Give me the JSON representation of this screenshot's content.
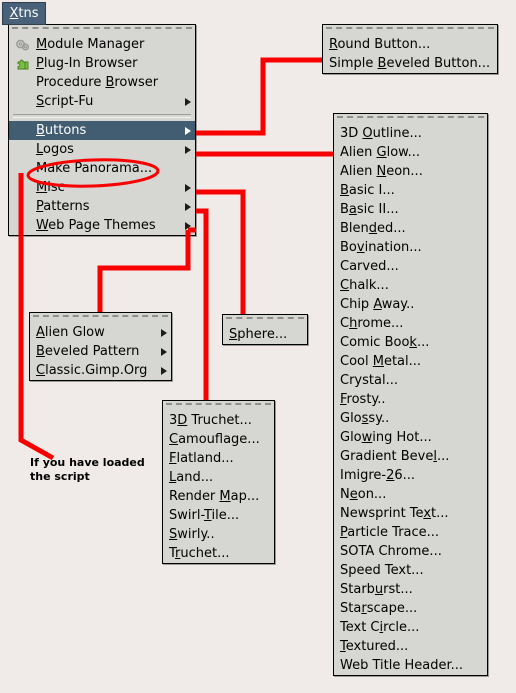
{
  "tab": {
    "label": "Xtns",
    "accel": "X",
    "bg": "#4a6279",
    "fg": "#ffffff"
  },
  "colors": {
    "background": "#f0ebe9",
    "menu_face": "#d6d6d2",
    "highlight": "#425c72",
    "annotation_red": "#f90000"
  },
  "main_menu": {
    "name": "Xtns menu",
    "items": [
      {
        "label": "Module Manager",
        "accel": "M",
        "icon": "gears-icon",
        "submenu": false
      },
      {
        "label": "Plug-In Browser",
        "accel": "P",
        "icon": "puzzle-piece-icon",
        "submenu": false
      },
      {
        "label": "Procedure Browser",
        "accel": "B",
        "icon": "",
        "submenu": false
      },
      {
        "label": "Script-Fu",
        "accel": "S",
        "icon": "",
        "submenu": true
      },
      {
        "separator": true
      },
      {
        "label": "Buttons",
        "accel": "B",
        "icon": "",
        "submenu": true,
        "selected": true
      },
      {
        "label": "Logos",
        "accel": "L",
        "icon": "",
        "submenu": true
      },
      {
        "label": "Make Panorama...",
        "accel": "",
        "icon": "",
        "submenu": false,
        "circled": true
      },
      {
        "label": "Misc",
        "accel": "M",
        "icon": "",
        "submenu": true
      },
      {
        "label": "Patterns",
        "accel": "P",
        "icon": "",
        "submenu": true
      },
      {
        "label": "Web Page Themes",
        "accel": "W",
        "icon": "",
        "submenu": true
      }
    ]
  },
  "buttons_menu": {
    "name": "Buttons submenu",
    "items": [
      {
        "label": "Round Button...",
        "accel": "R"
      },
      {
        "label": "Simple Beveled Button...",
        "accel": "B"
      }
    ]
  },
  "logos_menu": {
    "name": "Logos submenu",
    "items": [
      {
        "label": "3D Outline...",
        "accel": "O"
      },
      {
        "label": "Alien Glow...",
        "accel": "G"
      },
      {
        "label": "Alien Neon...",
        "accel": "N"
      },
      {
        "label": "Basic I...",
        "accel": "B"
      },
      {
        "label": "Basic II...",
        "accel": "a"
      },
      {
        "label": "Blended...",
        "accel": "d"
      },
      {
        "label": "Bovination...",
        "accel": "v"
      },
      {
        "label": "Carved...",
        "accel": ""
      },
      {
        "label": "Chalk...",
        "accel": "C"
      },
      {
        "label": "Chip Away..",
        "accel": "A"
      },
      {
        "label": "Chrome...",
        "accel": "h"
      },
      {
        "label": "Comic Book...",
        "accel": "k"
      },
      {
        "label": "Cool Metal...",
        "accel": "M"
      },
      {
        "label": "Crystal...",
        "accel": ""
      },
      {
        "label": "Frosty..",
        "accel": "F"
      },
      {
        "label": "Glossy..",
        "accel": "s"
      },
      {
        "label": "Glowing Hot...",
        "accel": "w"
      },
      {
        "label": "Gradient Bevel...",
        "accel": "l"
      },
      {
        "label": "Imigre-26...",
        "accel": "2"
      },
      {
        "label": "Neon...",
        "accel": "e"
      },
      {
        "label": "Newsprint Text...",
        "accel": "x"
      },
      {
        "label": "Particle Trace...",
        "accel": "P"
      },
      {
        "label": "SOTA Chrome...",
        "accel": ""
      },
      {
        "label": "Speed Text...",
        "accel": ""
      },
      {
        "label": "Starburst...",
        "accel": "u"
      },
      {
        "label": "Starscape...",
        "accel": "r"
      },
      {
        "label": "Text Circle...",
        "accel": "i"
      },
      {
        "label": "Textured...",
        "accel": "T"
      },
      {
        "label": "Web Title Header...",
        "accel": ""
      }
    ]
  },
  "misc_menu": {
    "name": "Misc submenu",
    "items": [
      {
        "label": "Sphere...",
        "accel": "S"
      }
    ]
  },
  "webpage_themes_menu": {
    "name": "Web Page Themes submenu",
    "items": [
      {
        "label": "Alien Glow",
        "accel": "A",
        "submenu": true
      },
      {
        "label": "Beveled Pattern",
        "accel": "B",
        "submenu": true
      },
      {
        "label": "Classic.Gimp.Org",
        "accel": "C",
        "submenu": true
      }
    ]
  },
  "patterns_menu": {
    "name": "Patterns submenu",
    "items": [
      {
        "label": "3D Truchet...",
        "accel": "D"
      },
      {
        "label": "Camouflage...",
        "accel": "C"
      },
      {
        "label": "Flatland...",
        "accel": "F"
      },
      {
        "label": "Land...",
        "accel": "L"
      },
      {
        "label": "Render Map...",
        "accel": "M"
      },
      {
        "label": "Swirl-Tile...",
        "accel": "T"
      },
      {
        "label": "Swirly..",
        "accel": "S"
      },
      {
        "label": "Truchet...",
        "accel": "r"
      }
    ]
  },
  "annotation": {
    "note_line1": "If you have loaded",
    "note_line2": "the script"
  }
}
